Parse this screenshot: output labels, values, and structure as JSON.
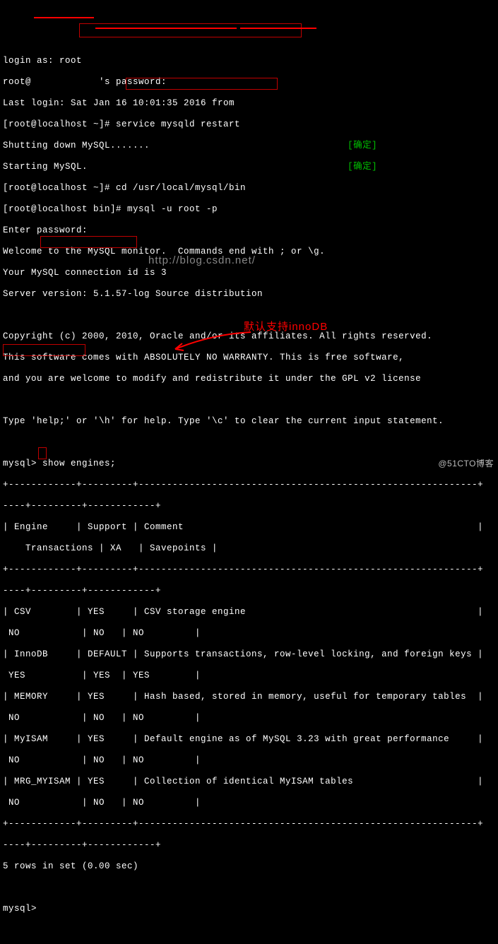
{
  "login": {
    "prompt": "login as: root",
    "pw_line": "root@            's password:",
    "last": "Last login: Sat Jan 16 10:01:35 2016 from                 ",
    "cmd1_prompt": "[root@localhost ~]# ",
    "cmd1": "service mysqld restart",
    "shut": "Shutting down MySQL.......",
    "start": "Starting MySQL.",
    "ok": "[确定]",
    "cmd2_prompt": "[root@localhost ~]# ",
    "cmd2": "cd /usr/local/mysql/bin",
    "cmd3_prompt": "[root@localhost bin]# ",
    "cmd3": "mysql -u root -p",
    "enter": "Enter password:"
  },
  "mysql": {
    "welcome": "Welcome to the MySQL monitor.  Commands end with ; or \\g.",
    "conn": "Your MySQL connection id is 3",
    "ver": "Server version: 5.1.57-log Source distribution",
    "copy": "Copyright (c) 2000, 2010, Oracle and/or its affiliates. All rights reserved.",
    "warr": "This software comes with ABSOLUTELY NO WARRANTY. This is free software,",
    "warr2": "and you are welcome to modify and redistribute it under the GPL v2 license",
    "help": "Type 'help;' or '\\h' for help. Type '\\c' to clear the current input statement.",
    "prompt": "mysql> ",
    "cmd": "show engines;"
  },
  "table": {
    "sep": "+------------+---------+------------------------------------------------------------+--------------+------+------------+",
    "sep2": "----+---------+------------+",
    "head": "| Engine     | Support | Comment                                                    | Transactions | XA   | Savepoints |",
    "r1a": "| CSV        | YES     | CSV storage engine                                         | NO           | NO   | NO         |",
    "r2a": "| InnoDB     | DEFAULT | Supports transactions, row-level locking, and foreign keys | YES          | YES  | YES        |",
    "r3a": "| MEMORY     | YES     | Hash based, stored in memory, useful for temporary tables  | NO           | NO   | NO         |",
    "r4a": "| MyISAM     | YES     | Default engine as of MySQL 3.23 with great performance     | NO           | NO   | NO         |",
    "r5a": "| MRG_MYISAM | YES     | Collection of identical MyISAM tables                      | NO           | NO   | NO         |",
    "footer": "5 rows in set (0.00 sec)"
  },
  "chart_data": {
    "type": "table",
    "title": "show engines;",
    "columns": [
      "Engine",
      "Support",
      "Comment",
      "Transactions",
      "XA",
      "Savepoints"
    ],
    "rows": [
      [
        "CSV",
        "YES",
        "CSV storage engine",
        "NO",
        "NO",
        "NO"
      ],
      [
        "InnoDB",
        "DEFAULT",
        "Supports transactions, row-level locking, and foreign keys",
        "YES",
        "YES",
        "YES"
      ],
      [
        "MEMORY",
        "YES",
        "Hash based, stored in memory, useful for temporary tables",
        "NO",
        "NO",
        "NO"
      ],
      [
        "MyISAM",
        "YES",
        "Default engine as of MySQL 3.23 with great performance",
        "NO",
        "NO",
        "NO"
      ],
      [
        "MRG_MYISAM",
        "YES",
        "Collection of identical MyISAM tables",
        "NO",
        "NO",
        "NO"
      ]
    ]
  },
  "annotation": "默认支持innoDB",
  "watermark": "http://blog.csdn.net/",
  "credit": "@51CTO博客"
}
